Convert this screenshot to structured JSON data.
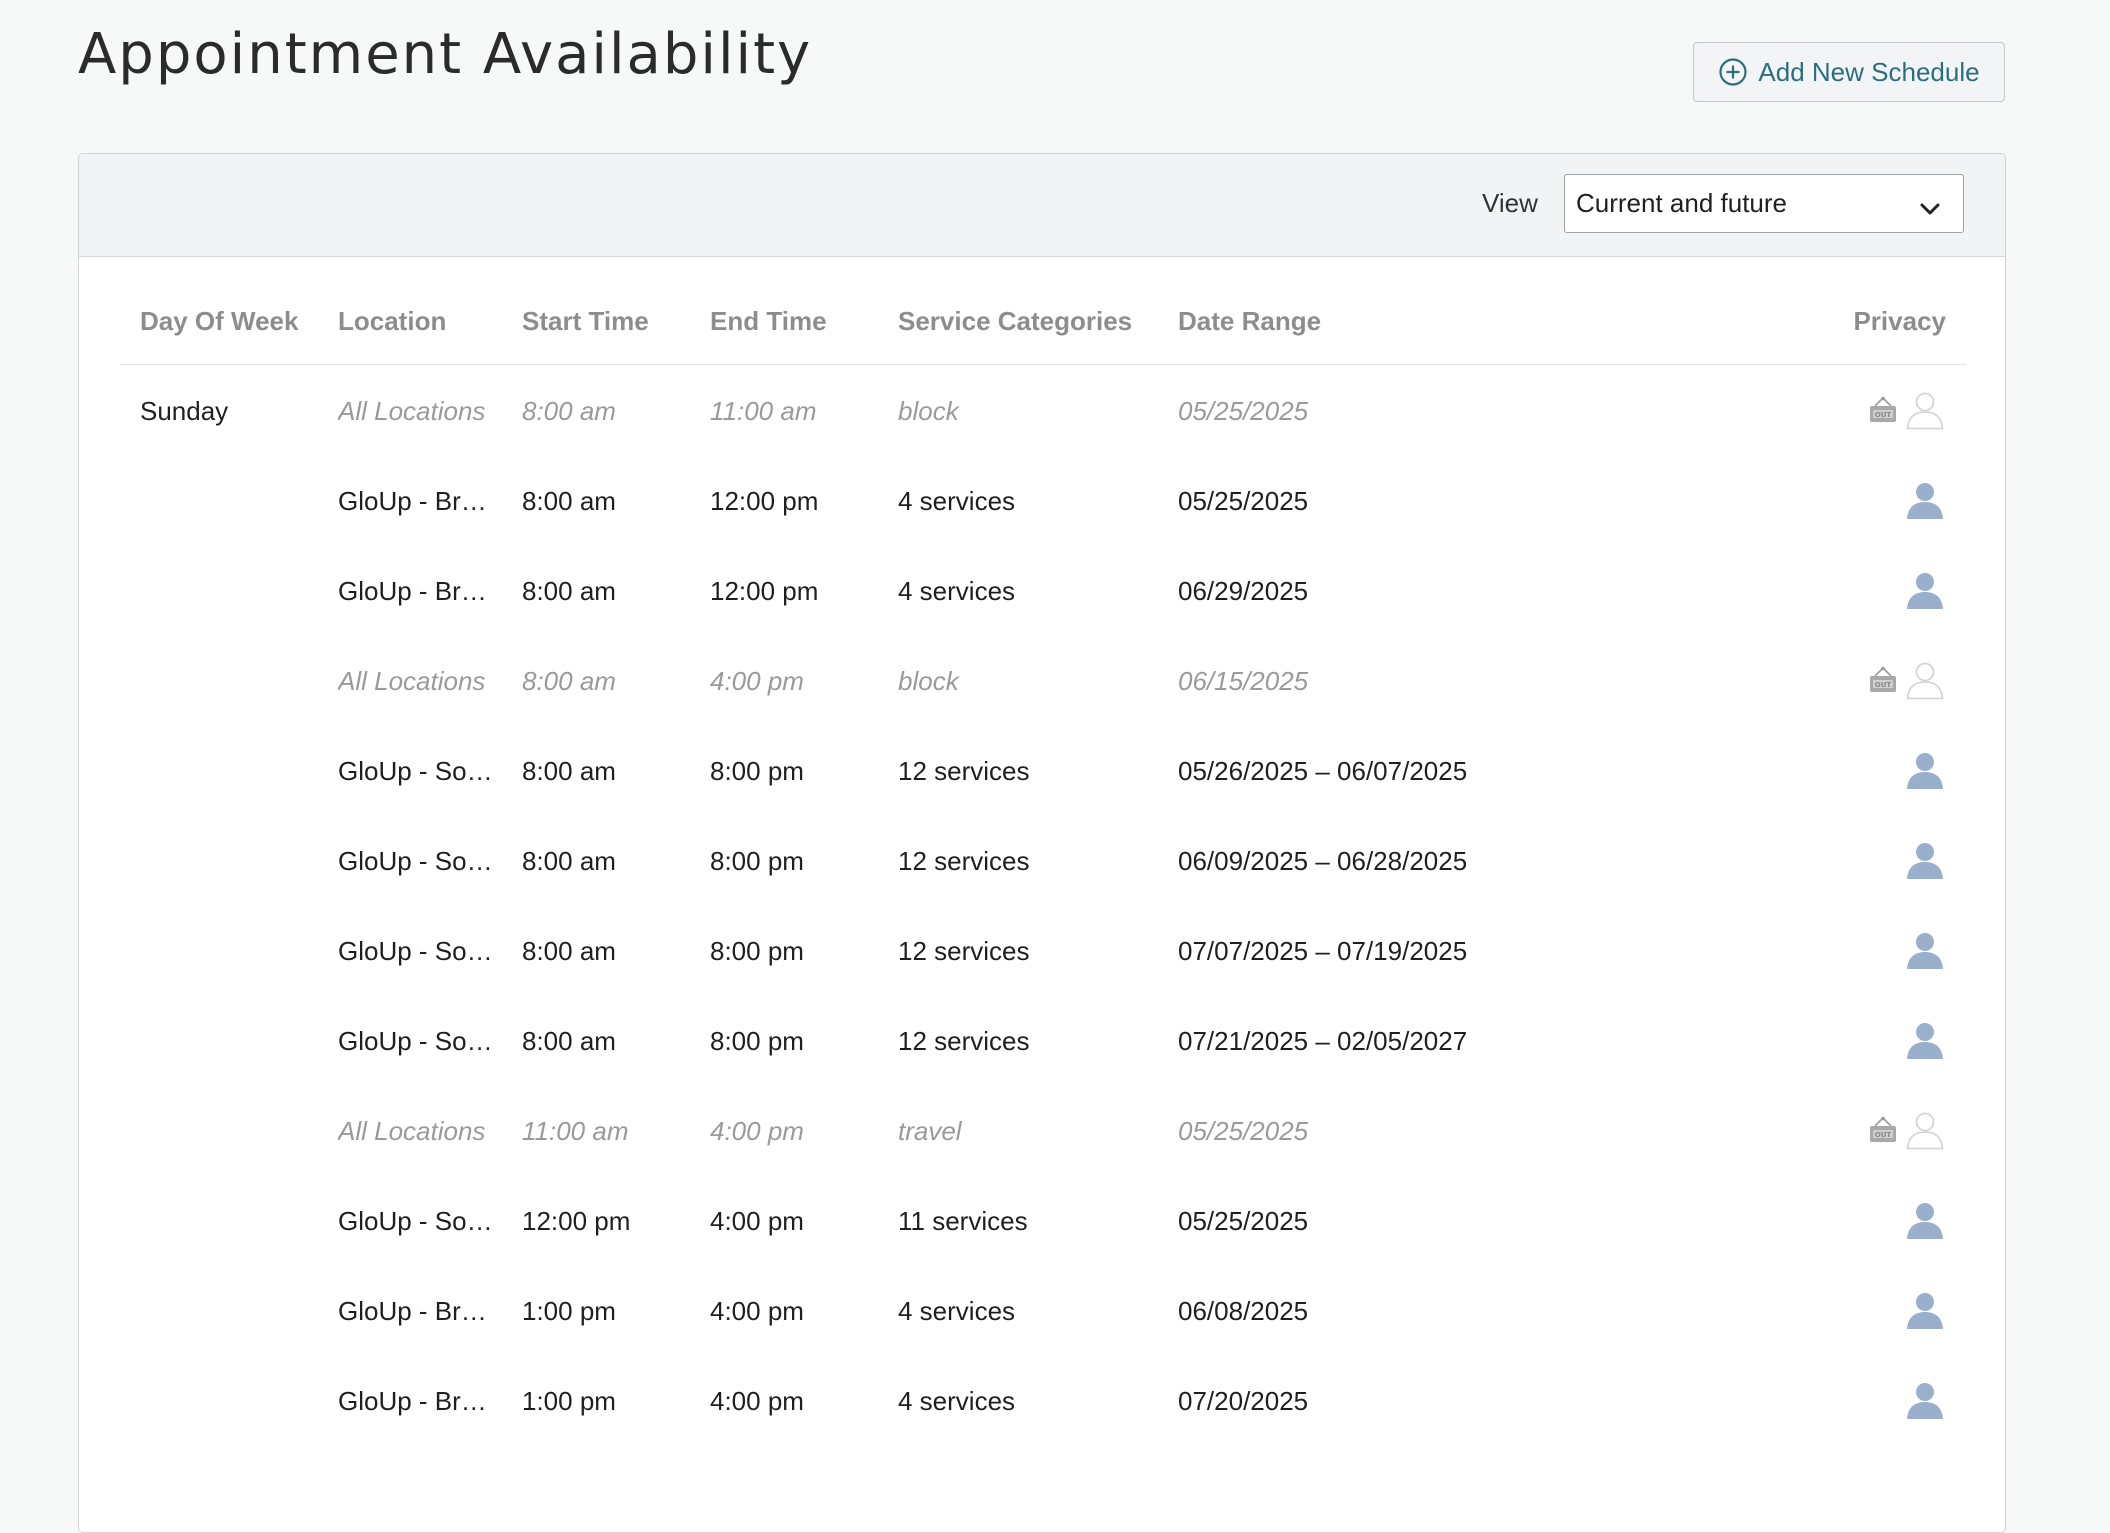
{
  "page": {
    "title": "Appointment Availability",
    "add_button_label": "Add New Schedule"
  },
  "filter": {
    "view_label": "View",
    "view_value": "Current and future"
  },
  "table": {
    "headers": {
      "day": "Day Of Week",
      "location": "Location",
      "start": "Start Time",
      "end": "End Time",
      "services": "Service Categories",
      "date_range": "Date Range",
      "privacy": "Privacy"
    },
    "rows": [
      {
        "day": "Sunday",
        "location": "All Locations",
        "start": "8:00 am",
        "end": "11:00 am",
        "services": "block",
        "date_range": "05/25/2025",
        "type": "block"
      },
      {
        "day": "",
        "location": "GloUp - Br…",
        "start": "8:00 am",
        "end": "12:00 pm",
        "services": "4 services",
        "date_range": "05/25/2025",
        "type": "public"
      },
      {
        "day": "",
        "location": "GloUp - Br…",
        "start": "8:00 am",
        "end": "12:00 pm",
        "services": "4 services",
        "date_range": "06/29/2025",
        "type": "public"
      },
      {
        "day": "",
        "location": "All Locations",
        "start": "8:00 am",
        "end": "4:00 pm",
        "services": "block",
        "date_range": "06/15/2025",
        "type": "block"
      },
      {
        "day": "",
        "location": "GloUp - So…",
        "start": "8:00 am",
        "end": "8:00 pm",
        "services": "12 services",
        "date_range": "05/26/2025 – 06/07/2025",
        "type": "public"
      },
      {
        "day": "",
        "location": "GloUp - So…",
        "start": "8:00 am",
        "end": "8:00 pm",
        "services": "12 services",
        "date_range": "06/09/2025 – 06/28/2025",
        "type": "public"
      },
      {
        "day": "",
        "location": "GloUp - So…",
        "start": "8:00 am",
        "end": "8:00 pm",
        "services": "12 services",
        "date_range": "07/07/2025 – 07/19/2025",
        "type": "public"
      },
      {
        "day": "",
        "location": "GloUp - So…",
        "start": "8:00 am",
        "end": "8:00 pm",
        "services": "12 services",
        "date_range": "07/21/2025 – 02/05/2027",
        "type": "public"
      },
      {
        "day": "",
        "location": "All Locations",
        "start": "11:00 am",
        "end": "4:00 pm",
        "services": "travel",
        "date_range": "05/25/2025",
        "type": "block"
      },
      {
        "day": "",
        "location": "GloUp - So…",
        "start": "12:00 pm",
        "end": "4:00 pm",
        "services": "11 services",
        "date_range": "05/25/2025",
        "type": "public"
      },
      {
        "day": "",
        "location": "GloUp - Br…",
        "start": "1:00 pm",
        "end": "4:00 pm",
        "services": "4 services",
        "date_range": "06/08/2025",
        "type": "public"
      },
      {
        "day": "",
        "location": "GloUp - Br…",
        "start": "1:00 pm",
        "end": "4:00 pm",
        "services": "4 services",
        "date_range": "07/20/2025",
        "type": "public"
      }
    ]
  },
  "icons": {
    "add": "plus-circle-icon",
    "dropdown": "chevron-down-icon",
    "block": "out-sign-icon",
    "public_user": "user-filled-icon",
    "private_user": "user-outline-icon"
  },
  "colors": {
    "accent": "#2a6f80",
    "user_icon": "#9aafcb",
    "muted_text": "#9a9a9a",
    "header_text": "#8d8d8d"
  }
}
